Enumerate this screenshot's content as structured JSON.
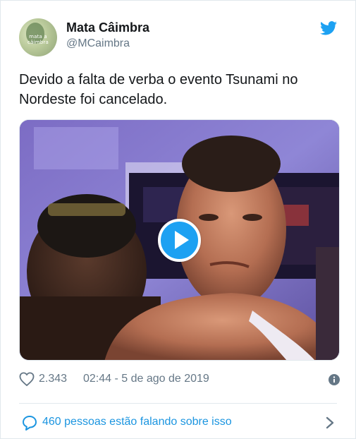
{
  "author": {
    "name": "Mata Câimbra",
    "handle": "@MCaimbra",
    "avatar_text": "mata a câimbra"
  },
  "tweet": {
    "text": "Devido a falta de verba o evento Tsunami no Nordeste foi cancelado."
  },
  "media": {
    "type": "video",
    "icon": "play-icon"
  },
  "meta": {
    "likes": "2.343",
    "timestamp": "02:44 - 5 de ago de 2019"
  },
  "footer": {
    "talking": "460 pessoas estão falando sobre isso"
  },
  "colors": {
    "accent": "#1da1f2",
    "link": "#1b95e0",
    "text": "#14171a",
    "muted": "#657786",
    "border": "#e1e8ed"
  },
  "icons": [
    "twitter-logo-icon",
    "heart-icon",
    "info-icon",
    "comment-bubble-icon",
    "chevron-right-icon",
    "play-icon"
  ]
}
